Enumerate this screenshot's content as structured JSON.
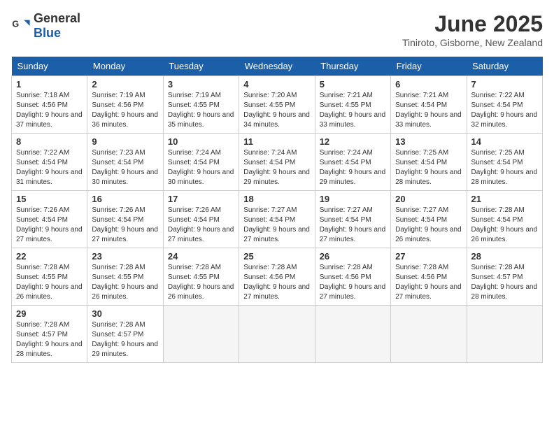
{
  "logo": {
    "general": "General",
    "blue": "Blue"
  },
  "header": {
    "month": "June 2025",
    "location": "Tiniroto, Gisborne, New Zealand"
  },
  "days_of_week": [
    "Sunday",
    "Monday",
    "Tuesday",
    "Wednesday",
    "Thursday",
    "Friday",
    "Saturday"
  ],
  "weeks": [
    [
      {
        "day": "1",
        "sunrise": "7:18 AM",
        "sunset": "4:56 PM",
        "daylight": "9 hours and 37 minutes."
      },
      {
        "day": "2",
        "sunrise": "7:19 AM",
        "sunset": "4:56 PM",
        "daylight": "9 hours and 36 minutes."
      },
      {
        "day": "3",
        "sunrise": "7:19 AM",
        "sunset": "4:55 PM",
        "daylight": "9 hours and 35 minutes."
      },
      {
        "day": "4",
        "sunrise": "7:20 AM",
        "sunset": "4:55 PM",
        "daylight": "9 hours and 34 minutes."
      },
      {
        "day": "5",
        "sunrise": "7:21 AM",
        "sunset": "4:55 PM",
        "daylight": "9 hours and 33 minutes."
      },
      {
        "day": "6",
        "sunrise": "7:21 AM",
        "sunset": "4:54 PM",
        "daylight": "9 hours and 33 minutes."
      },
      {
        "day": "7",
        "sunrise": "7:22 AM",
        "sunset": "4:54 PM",
        "daylight": "9 hours and 32 minutes."
      }
    ],
    [
      {
        "day": "8",
        "sunrise": "7:22 AM",
        "sunset": "4:54 PM",
        "daylight": "9 hours and 31 minutes."
      },
      {
        "day": "9",
        "sunrise": "7:23 AM",
        "sunset": "4:54 PM",
        "daylight": "9 hours and 30 minutes."
      },
      {
        "day": "10",
        "sunrise": "7:24 AM",
        "sunset": "4:54 PM",
        "daylight": "9 hours and 30 minutes."
      },
      {
        "day": "11",
        "sunrise": "7:24 AM",
        "sunset": "4:54 PM",
        "daylight": "9 hours and 29 minutes."
      },
      {
        "day": "12",
        "sunrise": "7:24 AM",
        "sunset": "4:54 PM",
        "daylight": "9 hours and 29 minutes."
      },
      {
        "day": "13",
        "sunrise": "7:25 AM",
        "sunset": "4:54 PM",
        "daylight": "9 hours and 28 minutes."
      },
      {
        "day": "14",
        "sunrise": "7:25 AM",
        "sunset": "4:54 PM",
        "daylight": "9 hours and 28 minutes."
      }
    ],
    [
      {
        "day": "15",
        "sunrise": "7:26 AM",
        "sunset": "4:54 PM",
        "daylight": "9 hours and 27 minutes."
      },
      {
        "day": "16",
        "sunrise": "7:26 AM",
        "sunset": "4:54 PM",
        "daylight": "9 hours and 27 minutes."
      },
      {
        "day": "17",
        "sunrise": "7:26 AM",
        "sunset": "4:54 PM",
        "daylight": "9 hours and 27 minutes."
      },
      {
        "day": "18",
        "sunrise": "7:27 AM",
        "sunset": "4:54 PM",
        "daylight": "9 hours and 27 minutes."
      },
      {
        "day": "19",
        "sunrise": "7:27 AM",
        "sunset": "4:54 PM",
        "daylight": "9 hours and 27 minutes."
      },
      {
        "day": "20",
        "sunrise": "7:27 AM",
        "sunset": "4:54 PM",
        "daylight": "9 hours and 26 minutes."
      },
      {
        "day": "21",
        "sunrise": "7:28 AM",
        "sunset": "4:54 PM",
        "daylight": "9 hours and 26 minutes."
      }
    ],
    [
      {
        "day": "22",
        "sunrise": "7:28 AM",
        "sunset": "4:55 PM",
        "daylight": "9 hours and 26 minutes."
      },
      {
        "day": "23",
        "sunrise": "7:28 AM",
        "sunset": "4:55 PM",
        "daylight": "9 hours and 26 minutes."
      },
      {
        "day": "24",
        "sunrise": "7:28 AM",
        "sunset": "4:55 PM",
        "daylight": "9 hours and 26 minutes."
      },
      {
        "day": "25",
        "sunrise": "7:28 AM",
        "sunset": "4:56 PM",
        "daylight": "9 hours and 27 minutes."
      },
      {
        "day": "26",
        "sunrise": "7:28 AM",
        "sunset": "4:56 PM",
        "daylight": "9 hours and 27 minutes."
      },
      {
        "day": "27",
        "sunrise": "7:28 AM",
        "sunset": "4:56 PM",
        "daylight": "9 hours and 27 minutes."
      },
      {
        "day": "28",
        "sunrise": "7:28 AM",
        "sunset": "4:57 PM",
        "daylight": "9 hours and 28 minutes."
      }
    ],
    [
      {
        "day": "29",
        "sunrise": "7:28 AM",
        "sunset": "4:57 PM",
        "daylight": "9 hours and 28 minutes."
      },
      {
        "day": "30",
        "sunrise": "7:28 AM",
        "sunset": "4:57 PM",
        "daylight": "9 hours and 29 minutes."
      },
      null,
      null,
      null,
      null,
      null
    ]
  ]
}
